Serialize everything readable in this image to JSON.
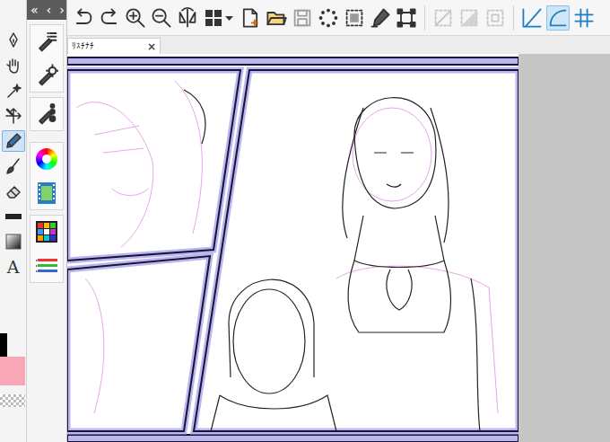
{
  "panel_nav": [
    "«",
    "‹",
    "›"
  ],
  "tools": [
    {
      "selected": false
    },
    {
      "selected": false
    },
    {
      "selected": false
    },
    {
      "selected": false
    },
    {
      "selected": true
    },
    {
      "selected": false
    },
    {
      "selected": false
    },
    {
      "selected": false
    },
    {
      "selected": false
    },
    {
      "selected": false,
      "glyph": "A"
    }
  ],
  "colors": {
    "primary": "#000000",
    "secondary": "#f8a7b6"
  },
  "toolbar": [
    {
      "selected": false,
      "disabled": false
    },
    {
      "selected": false,
      "disabled": false
    },
    {
      "selected": false,
      "disabled": false
    },
    {
      "selected": false,
      "disabled": false
    },
    {
      "selected": false,
      "disabled": false
    },
    {
      "selected": false,
      "disabled": false
    },
    {
      "selected": false,
      "disabled": false
    },
    {
      "selected": false,
      "disabled": false
    },
    {
      "selected": false,
      "disabled": true
    },
    {
      "selected": false,
      "disabled": false
    },
    {
      "selected": false,
      "disabled": false
    },
    {
      "selected": false,
      "disabled": false
    },
    {
      "selected": false,
      "disabled": false
    },
    {
      "selected": false,
      "disabled": true
    },
    {
      "selected": false,
      "disabled": true
    },
    {
      "selected": false,
      "disabled": true
    },
    {
      "selected": false,
      "disabled": false
    },
    {
      "selected": true,
      "disabled": false
    },
    {
      "selected": false,
      "disabled": false
    }
  ],
  "document_tab": {
    "label": "ﾘｽﾁﾅﾁ",
    "close": "×",
    "selected": true
  }
}
